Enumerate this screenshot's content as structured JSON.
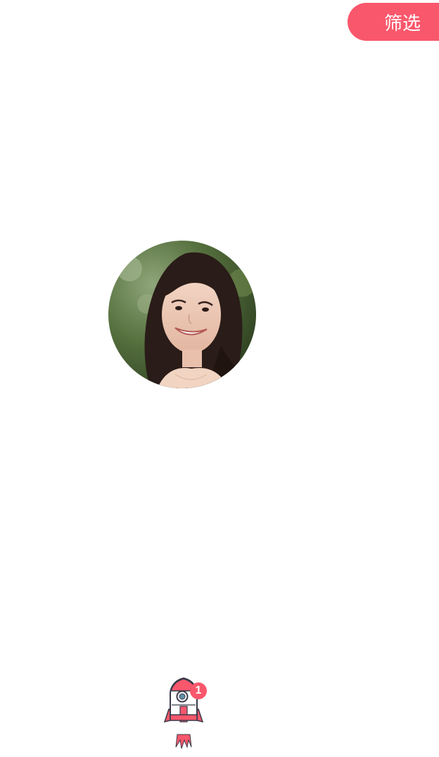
{
  "header": {
    "filter_label": "筛选"
  },
  "profile": {
    "avatar_icon": "user-photo-avatar"
  },
  "boost": {
    "icon": "rocket-icon",
    "badge_count": "1"
  },
  "colors": {
    "accent": "#f9576c",
    "background": "#ffffff"
  }
}
